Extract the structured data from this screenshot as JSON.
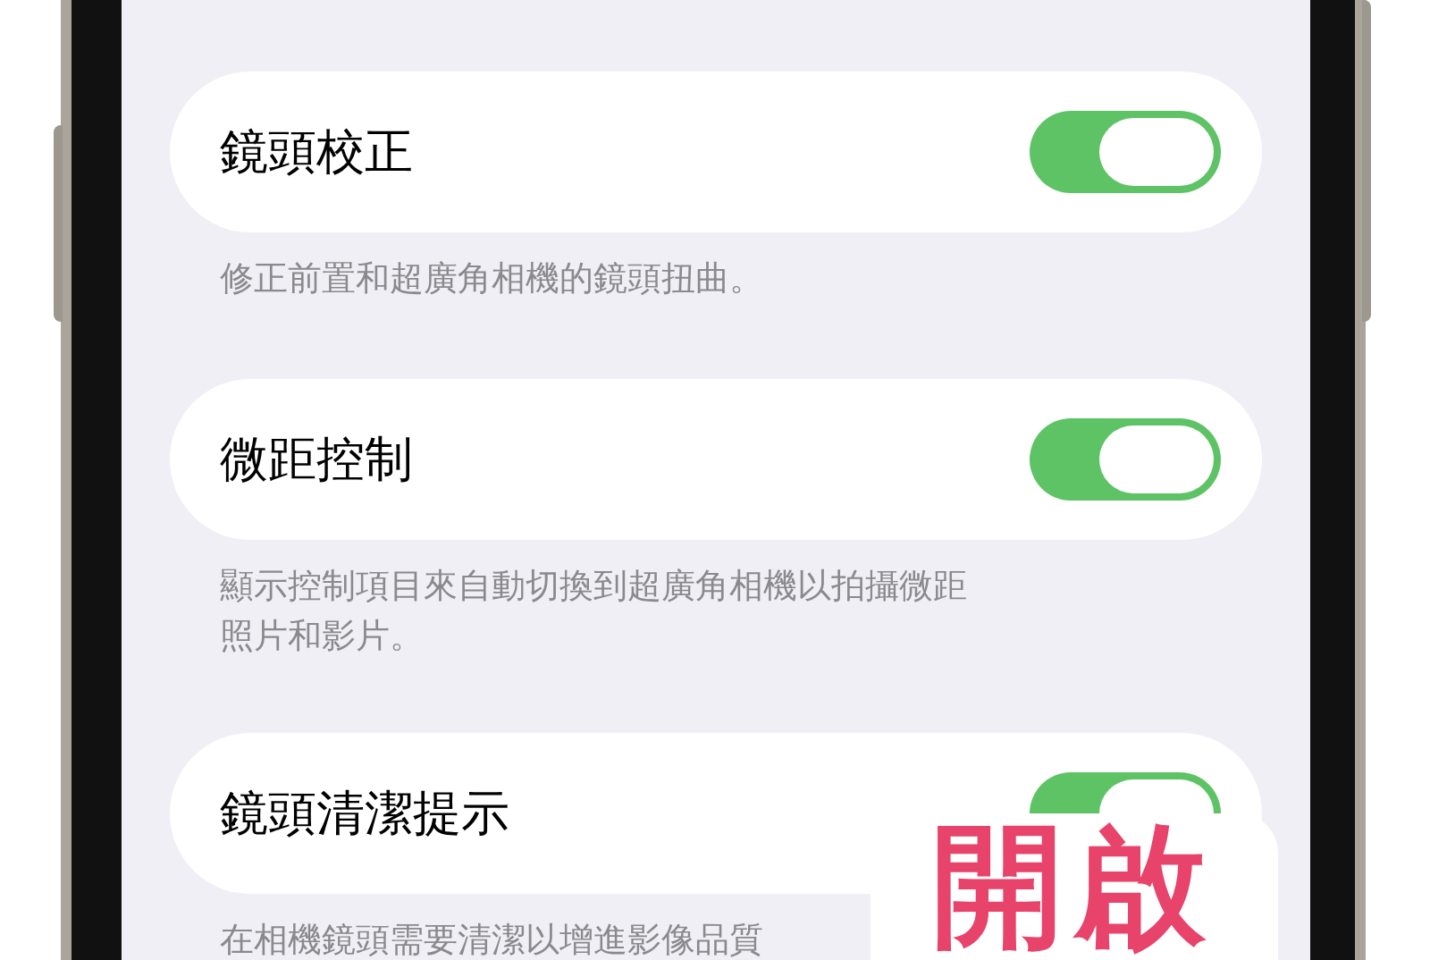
{
  "settings": [
    {
      "label": "鏡頭校正",
      "on": true,
      "footer": [
        "修正前置和超廣角相機的鏡頭扭曲。"
      ]
    },
    {
      "label": "微距控制",
      "on": true,
      "footer": [
        "顯示控制項目來自動切換到超廣角相機以拍攝微距",
        "照片和影片。"
      ]
    },
    {
      "label": "鏡頭清潔提示",
      "on": true,
      "footer": [
        "在相機鏡頭需要清潔以增進影像品質"
      ]
    }
  ],
  "sticker": {
    "text": "開啟"
  }
}
